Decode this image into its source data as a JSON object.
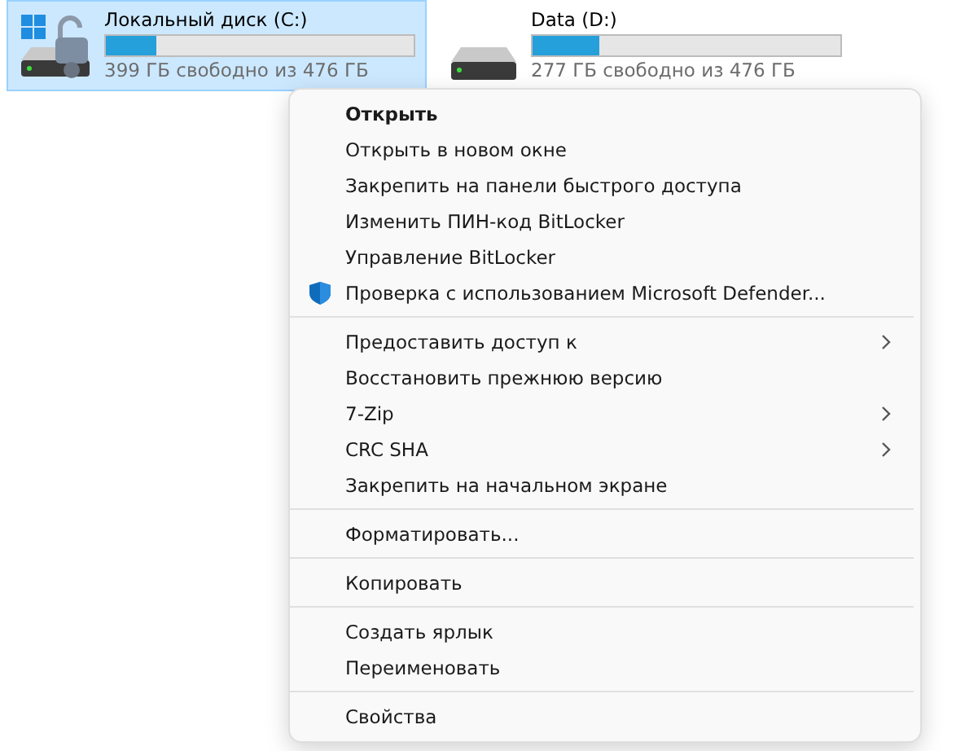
{
  "drives": [
    {
      "kind": "system",
      "name": "Локальный диск (C:)",
      "level": 0.165,
      "free": "399 ГБ свободно из 476 ГБ",
      "selected": true
    },
    {
      "kind": "data",
      "name": "Data (D:)",
      "level": 0.215,
      "free": "277 ГБ свободно из 476 ГБ",
      "selected": false
    }
  ],
  "context_menu": {
    "items": [
      {
        "kind": "item",
        "label": "Открыть",
        "bold": true,
        "submenu": false
      },
      {
        "kind": "item",
        "label": "Открыть в новом окне",
        "bold": false,
        "submenu": false
      },
      {
        "kind": "item",
        "label": "Закрепить на панели быстрого доступа",
        "bold": false,
        "submenu": false
      },
      {
        "kind": "item",
        "label": "Изменить ПИН-код BitLocker",
        "bold": false,
        "submenu": false
      },
      {
        "kind": "item",
        "label": "Управление BitLocker",
        "bold": false,
        "submenu": false
      },
      {
        "kind": "icon_item",
        "label": "Проверка с использованием Microsoft Defender...",
        "bold": false,
        "submenu": false
      },
      {
        "kind": "separator"
      },
      {
        "kind": "item",
        "label": "Предоставить доступ к",
        "bold": false,
        "submenu": true
      },
      {
        "kind": "item",
        "label": "Восстановить прежнюю версию",
        "bold": false,
        "submenu": false
      },
      {
        "kind": "item",
        "label": "7-Zip",
        "bold": false,
        "submenu": true
      },
      {
        "kind": "item",
        "label": "CRC SHA",
        "bold": false,
        "submenu": true
      },
      {
        "kind": "item",
        "label": "Закрепить на начальном экране",
        "bold": false,
        "submenu": false
      },
      {
        "kind": "separator"
      },
      {
        "kind": "item",
        "label": "Форматировать...",
        "bold": false,
        "submenu": false
      },
      {
        "kind": "separator"
      },
      {
        "kind": "item",
        "label": "Копировать",
        "bold": false,
        "submenu": false
      },
      {
        "kind": "separator"
      },
      {
        "kind": "item",
        "label": "Создать ярлык",
        "bold": false,
        "submenu": false
      },
      {
        "kind": "item",
        "label": "Переименовать",
        "bold": false,
        "submenu": false
      },
      {
        "kind": "separator"
      },
      {
        "kind": "item",
        "label": "Свойства",
        "bold": false,
        "submenu": false
      }
    ]
  }
}
